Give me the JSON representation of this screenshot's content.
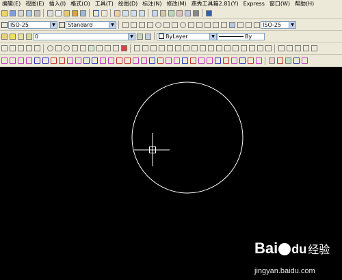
{
  "menu": [
    "编辑(E)",
    "视图(E)",
    "插入(I)",
    "格式(O)",
    "工具(T)",
    "绘图(D)",
    "标注(N)",
    "修改(M)",
    "燕秀工具箱2.81(Y)",
    "Express",
    "窗口(W)",
    "帮助(H)"
  ],
  "styles": {
    "text_style": "ISO-25",
    "dim_style": "Standard",
    "table_style": "ISO-25"
  },
  "layers": {
    "current_layer": "0",
    "color": "ByLayer",
    "linetype": "By"
  },
  "watermark": {
    "logo_a": "Bai",
    "logo_b": "du",
    "logo_c": "经验",
    "url": "jingyan.baidu.com"
  },
  "colors": {
    "canvas": "#000000",
    "entity": "#ffffff",
    "toolbar": "#ece9d8"
  }
}
